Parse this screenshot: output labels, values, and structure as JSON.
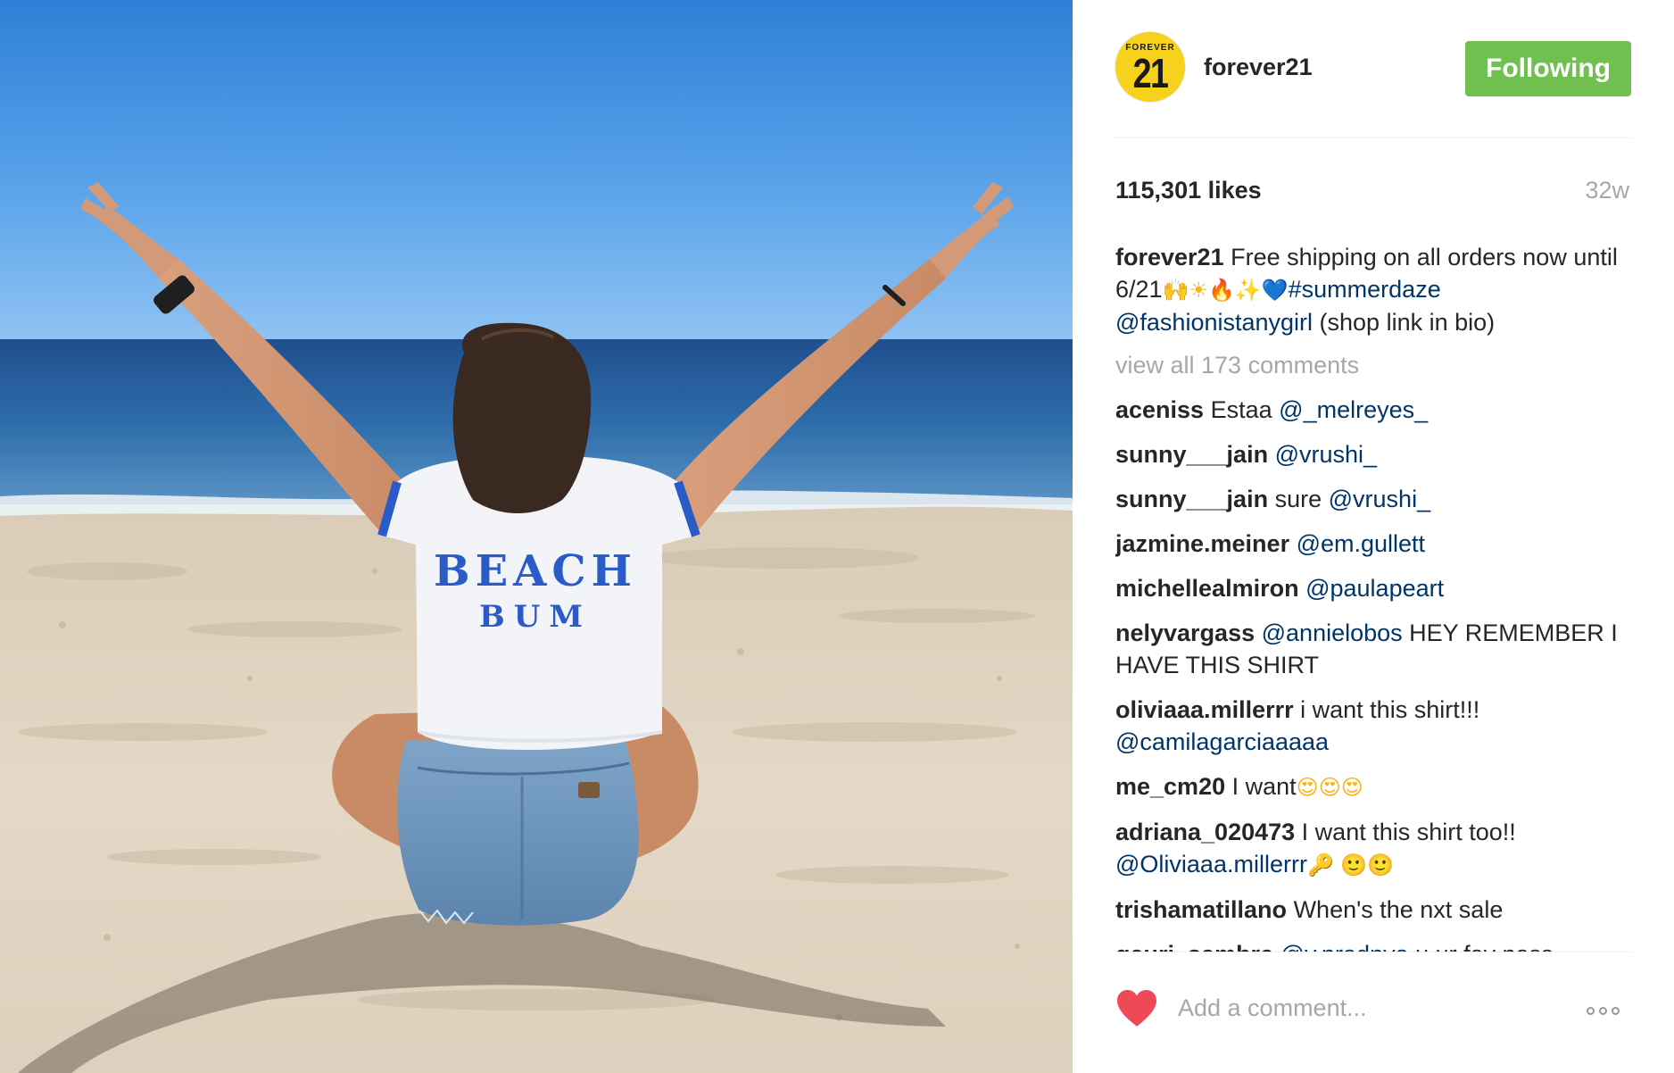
{
  "post": {
    "image_alt": "Woman in a BEACH BUM t-shirt sitting on the sand with arms raised toward the ocean",
    "shirt_text_line1": "BEACH",
    "shirt_text_line2": "BUM"
  },
  "header": {
    "avatar_brand_small": "FOREVER",
    "avatar_brand_big": "21",
    "username": "forever21",
    "follow_label": "Following",
    "follow_color": "#70c050"
  },
  "stats": {
    "likes": "115,301 likes",
    "age": "32w"
  },
  "caption": {
    "user": "forever21",
    "text": "Free shipping on all orders now until 6/21",
    "emojis": [
      "🙌",
      "☀",
      "🔥",
      "✨",
      "💙"
    ],
    "hashtag": "#summerdaze",
    "mention": "@fashionistanygirl",
    "tail": "(shop link in bio)"
  },
  "view_all": "view all 173 comments",
  "comments": [
    {
      "user": "aceniss",
      "text": "Estaa",
      "mention": "@_melreyes_"
    },
    {
      "user": "sunny___jain",
      "text": "",
      "mention": "@vrushi_"
    },
    {
      "user": "sunny___jain",
      "text": "sure",
      "mention": "@vrushi_"
    },
    {
      "user": "jazmine.meiner",
      "text": "",
      "mention": "@em.gullett"
    },
    {
      "user": "michellealmiron",
      "text": "",
      "mention": "@paulapeart"
    },
    {
      "user": "nelyvargass",
      "mention": "@annielobos",
      "text_after": "HEY REMEMBER I HAVE THIS SHIRT"
    },
    {
      "user": "oliviaaa.millerrr",
      "text": "i want this shirt!!!",
      "mention": "@camilagarciaaaaa"
    },
    {
      "user": "me_cm20",
      "text": "I want",
      "emojis": [
        "😍",
        "😍",
        "😍"
      ]
    },
    {
      "user": "adriana_020473",
      "text": "I want this shirt too!!",
      "mention": "@Oliviaaa.millerrr",
      "emojis": [
        "🔑",
        "🙂",
        "🙂"
      ]
    },
    {
      "user": "trishamatillano",
      "text": "When's the nxt sale",
      "mention": ""
    },
    {
      "user": "gauri_sambre",
      "text": "u ur fav pass",
      "mention": "@v.pradnya"
    }
  ],
  "add_comment": {
    "placeholder": "Add a comment...",
    "heart_color": "#ed4956"
  },
  "icons": {
    "like": "heart-icon",
    "more": "more-options-icon"
  }
}
